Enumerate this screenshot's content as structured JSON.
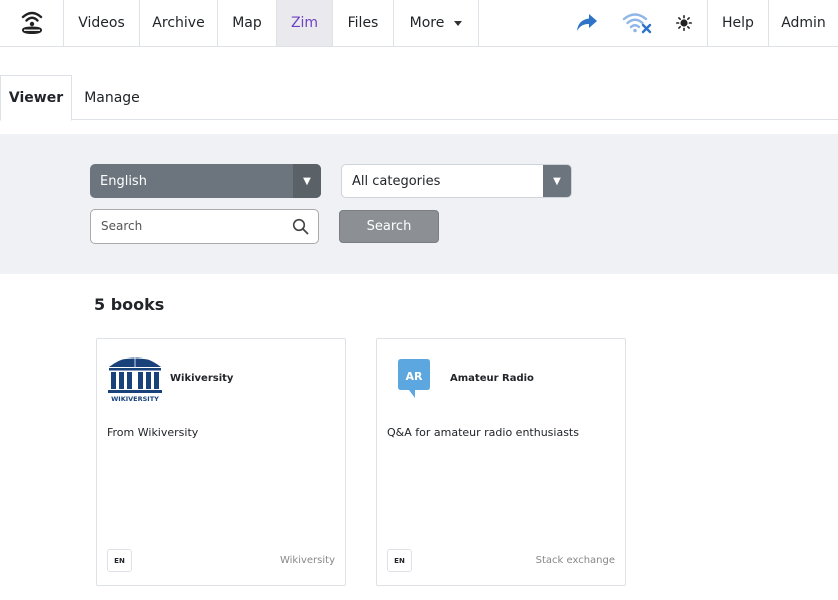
{
  "nav": {
    "items": [
      {
        "label": "Videos"
      },
      {
        "label": "Archive"
      },
      {
        "label": "Map"
      },
      {
        "label": "Zim"
      },
      {
        "label": "Files"
      },
      {
        "label": "More"
      }
    ],
    "active": "Zim",
    "right_items": [
      {
        "label": "Help"
      },
      {
        "label": "Admin"
      }
    ],
    "icons": [
      "hotspot-logo-icon",
      "share-icon",
      "wifi-off-icon",
      "brightness-icon"
    ],
    "accent_color": "#6f42c1",
    "share_color": "#2e73c7",
    "wifi_color": "#2e73c7"
  },
  "tabs": [
    {
      "label": "Viewer"
    },
    {
      "label": "Manage"
    }
  ],
  "filters": {
    "language": "English",
    "category": "All categories",
    "search_placeholder": "Search",
    "search_button": "Search"
  },
  "results": {
    "count_label": "5 books",
    "cards": [
      {
        "title": "Wikiversity",
        "description": "From Wikiversity",
        "lang": "EN",
        "source": "Wikiversity",
        "icon": "wikiversity-logo-icon",
        "logo_text": "WIKIVERSITY"
      },
      {
        "title": "Amateur Radio",
        "description": "Q&A for amateur radio enthusiasts",
        "lang": "EN",
        "source": "Stack exchange",
        "icon": "amateur-radio-icon",
        "logo_text": "AR"
      }
    ]
  }
}
